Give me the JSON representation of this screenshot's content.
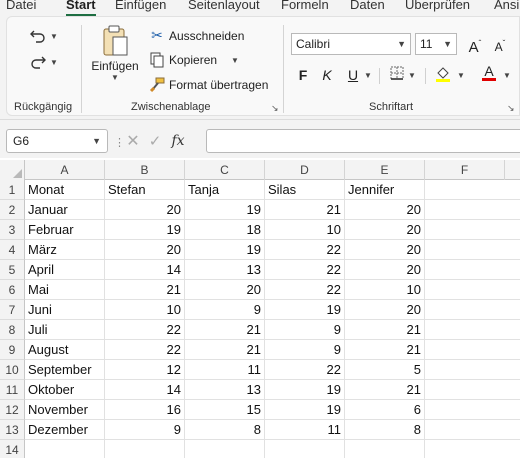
{
  "menu": {
    "tabs": [
      "Datei",
      "Start",
      "Einfügen",
      "Seitenlayout",
      "Formeln",
      "Daten",
      "Überprüfen",
      "Ansi"
    ],
    "active_tab": "Start"
  },
  "ribbon": {
    "groups": {
      "undo": "Rückgängig",
      "clipboard": "Zwischenablage",
      "font": "Schriftart"
    },
    "paste_label": "Einfügen",
    "cut_label": "Ausschneiden",
    "copy_label": "Kopieren",
    "format_painter_label": "Format übertragen",
    "font_name": "Calibri",
    "font_size": "11",
    "bold_label": "F",
    "italic_label": "K",
    "underline_label": "U",
    "grow_label": "A",
    "shrink_label": "A",
    "fill_color": "#ffff00",
    "font_color": "#e00000"
  },
  "formula_bar": {
    "name_box": "G6",
    "fx_label": "fx",
    "formula": ""
  },
  "sheet": {
    "columns": [
      "A",
      "B",
      "C",
      "D",
      "E",
      "F"
    ],
    "headers": [
      "Monat",
      "Stefan",
      "Tanja",
      "Silas",
      "Jennifer"
    ],
    "rows": [
      {
        "num": "1",
        "cells": [
          "Monat",
          "Stefan",
          "Tanja",
          "Silas",
          "Jennifer"
        ]
      },
      {
        "num": "2",
        "cells": [
          "Januar",
          "20",
          "19",
          "21",
          "20"
        ]
      },
      {
        "num": "3",
        "cells": [
          "Februar",
          "19",
          "18",
          "10",
          "20"
        ]
      },
      {
        "num": "4",
        "cells": [
          "März",
          "20",
          "19",
          "22",
          "20"
        ]
      },
      {
        "num": "5",
        "cells": [
          "April",
          "14",
          "13",
          "22",
          "20"
        ]
      },
      {
        "num": "6",
        "cells": [
          "Mai",
          "21",
          "20",
          "22",
          "10"
        ]
      },
      {
        "num": "7",
        "cells": [
          "Juni",
          "10",
          "9",
          "19",
          "20"
        ]
      },
      {
        "num": "8",
        "cells": [
          "Juli",
          "22",
          "21",
          "9",
          "21"
        ]
      },
      {
        "num": "9",
        "cells": [
          "August",
          "22",
          "21",
          "9",
          "21"
        ]
      },
      {
        "num": "10",
        "cells": [
          "September",
          "12",
          "11",
          "22",
          "5"
        ]
      },
      {
        "num": "11",
        "cells": [
          "Oktober",
          "14",
          "13",
          "19",
          "21"
        ]
      },
      {
        "num": "12",
        "cells": [
          "November",
          "16",
          "15",
          "19",
          "6"
        ]
      },
      {
        "num": "13",
        "cells": [
          "Dezember",
          "9",
          "8",
          "11",
          "8"
        ]
      },
      {
        "num": "14",
        "cells": [
          "",
          "",
          "",
          "",
          ""
        ]
      }
    ]
  }
}
